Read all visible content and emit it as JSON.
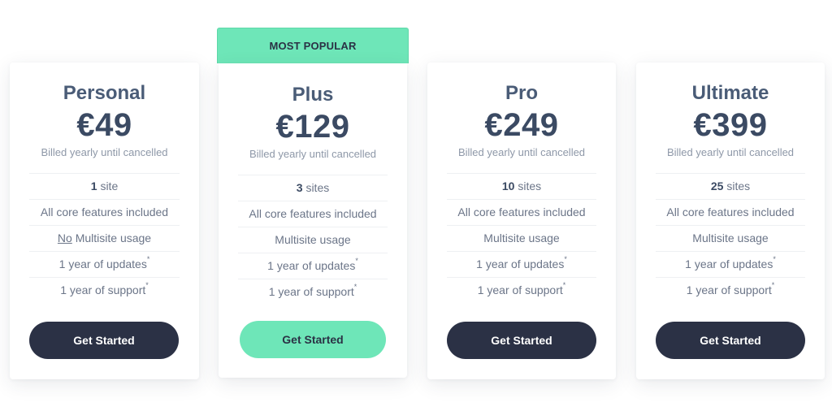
{
  "badge": {
    "label": "MOST POPULAR",
    "color": "#6ee6b8"
  },
  "plans": [
    {
      "name": "Personal",
      "price": "€49",
      "billing": "Billed yearly until cancelled",
      "sites_count": "1",
      "sites_unit": "site",
      "features": {
        "core": "All core features included",
        "multisite_prefix": "No",
        "multisite": "Multisite usage",
        "updates": "1 year of updates",
        "support": "1 year of support",
        "footnote_mark": "*"
      },
      "button": "Get Started"
    },
    {
      "name": "Plus",
      "price": "€129",
      "billing": "Billed yearly until cancelled",
      "sites_count": "3",
      "sites_unit": "sites",
      "features": {
        "core": "All core features included",
        "multisite": "Multisite usage",
        "updates": "1 year of updates",
        "support": "1 year of support",
        "footnote_mark": "*"
      },
      "button": "Get Started",
      "highlighted": true
    },
    {
      "name": "Pro",
      "price": "€249",
      "billing": "Billed yearly until cancelled",
      "sites_count": "10",
      "sites_unit": "sites",
      "features": {
        "core": "All core features included",
        "multisite": "Multisite usage",
        "updates": "1 year of updates",
        "support": "1 year of support",
        "footnote_mark": "*"
      },
      "button": "Get Started"
    },
    {
      "name": "Ultimate",
      "price": "€399",
      "billing": "Billed yearly until cancelled",
      "sites_count": "25",
      "sites_unit": "sites",
      "features": {
        "core": "All core features included",
        "multisite": "Multisite usage",
        "updates": "1 year of updates",
        "support": "1 year of support",
        "footnote_mark": "*"
      },
      "button": "Get Started"
    }
  ],
  "colors": {
    "dark_button": "#2b3145",
    "accent": "#6ee6b8",
    "heading": "#4a5c77"
  }
}
